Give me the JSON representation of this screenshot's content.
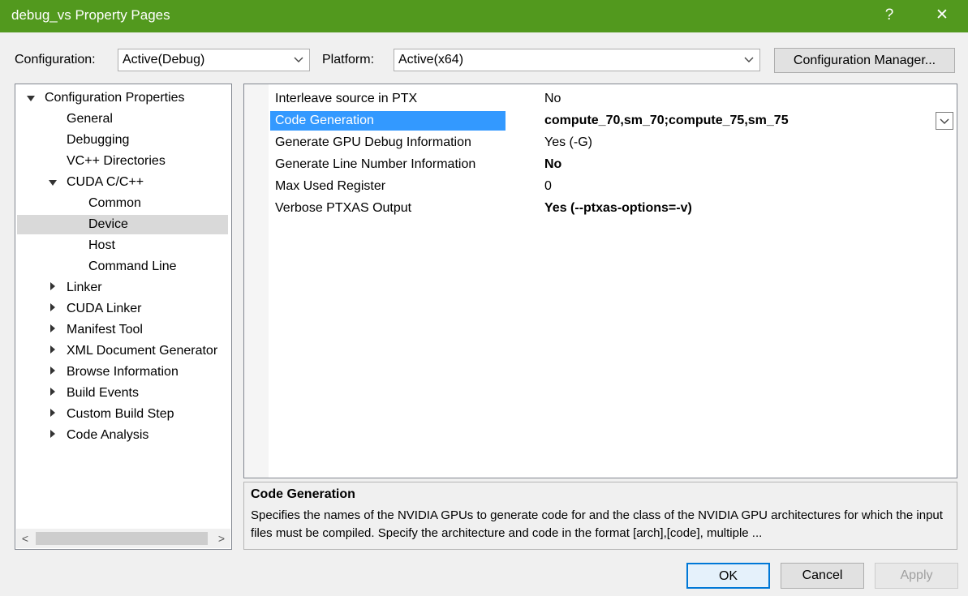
{
  "window": {
    "title": "debug_vs Property Pages",
    "help_glyph": "?",
    "close_glyph": "✕"
  },
  "toolbar": {
    "configuration_label": "Configuration:",
    "configuration_value": "Active(Debug)",
    "platform_label": "Platform:",
    "platform_value": "Active(x64)",
    "config_manager_label": "Configuration Manager..."
  },
  "tree": {
    "root": "Configuration Properties",
    "general": "General",
    "debugging": "Debugging",
    "vc_dirs": "VC++ Directories",
    "cuda_cpp": "CUDA C/C++",
    "common": "Common",
    "device": "Device",
    "host": "Host",
    "command_line": "Command Line",
    "linker": "Linker",
    "cuda_linker": "CUDA Linker",
    "manifest_tool": "Manifest Tool",
    "xml_doc": "XML Document Generator",
    "browse_info": "Browse Information",
    "build_events": "Build Events",
    "custom_build": "Custom Build Step",
    "code_analysis": "Code Analysis",
    "scroll_left": "<",
    "scroll_right": ">"
  },
  "properties": [
    {
      "name": "Interleave source in PTX",
      "value": "No",
      "bold": false
    },
    {
      "name": "Code Generation",
      "value": "compute_70,sm_70;compute_75,sm_75",
      "bold": true
    },
    {
      "name": "Generate GPU Debug Information",
      "value": "Yes (-G)",
      "bold": false
    },
    {
      "name": "Generate Line Number Information",
      "value": "No",
      "bold": true
    },
    {
      "name": "Max Used Register",
      "value": "0",
      "bold": false
    },
    {
      "name": "Verbose PTXAS Output",
      "value": "Yes (--ptxas-options=-v)",
      "bold": true
    }
  ],
  "description": {
    "title": "Code Generation",
    "text": "Specifies the names of the NVIDIA GPUs to generate code for and the class of the NVIDIA GPU architectures for which the input files must be compiled.  Specify the architecture and code in the format [arch],[code], multiple ..."
  },
  "buttons": {
    "ok": "OK",
    "cancel": "Cancel",
    "apply": "Apply"
  },
  "colors": {
    "titlebar": "#52991e",
    "selection": "#3399ff"
  }
}
